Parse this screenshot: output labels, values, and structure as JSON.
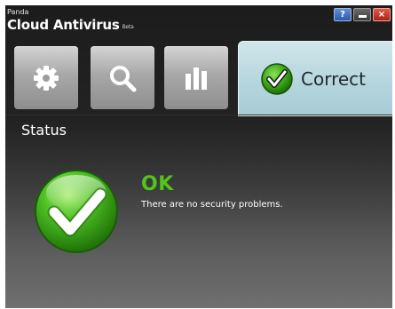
{
  "app": {
    "vendor": "Panda",
    "title": "Cloud Antivirus",
    "badge": "Beta"
  },
  "window_controls": {
    "help": "?",
    "minimize_icon": "minimize-icon",
    "close": "×"
  },
  "tabs": [
    {
      "id": "settings",
      "icon": "gear-icon"
    },
    {
      "id": "scan",
      "icon": "magnifier-icon"
    },
    {
      "id": "reports",
      "icon": "bar-chart-icon"
    },
    {
      "id": "status",
      "icon": "green-check-icon",
      "label": "Correct",
      "active": true
    }
  ],
  "main": {
    "section_title": "Status",
    "status_word": "OK",
    "status_message": "There are no security problems."
  },
  "colors": {
    "accent_green": "#52c41a",
    "active_tab": "#b4d4dc",
    "background": "#1c1c1c"
  }
}
